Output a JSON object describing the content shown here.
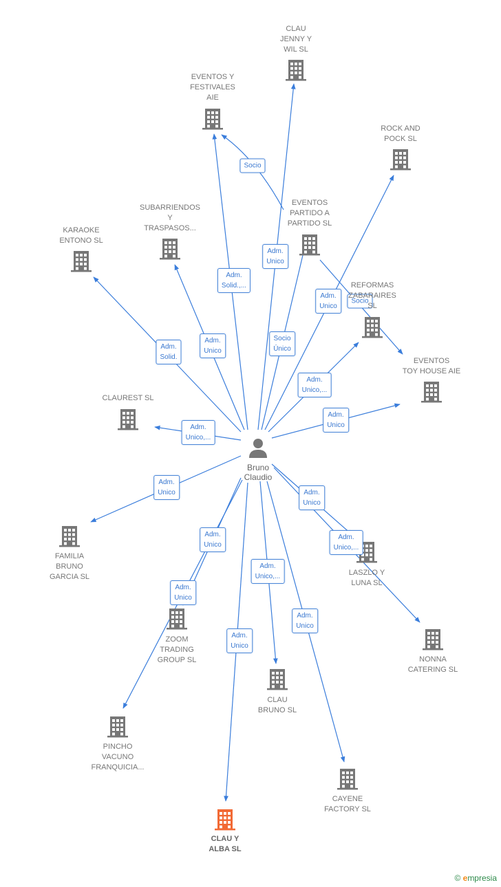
{
  "colors": {
    "edge": "#3a7ddb",
    "company": "#777777",
    "highlight": "#f26a35",
    "person": "#777777"
  },
  "person": {
    "name": "Bruno\nClaudio",
    "icon": "person-icon"
  },
  "nodes": [
    {
      "id": "clau-jenny",
      "label": "CLAU\nJENNY Y\nWIL  SL"
    },
    {
      "id": "eventos-festivales",
      "label": "EVENTOS Y\nFESTIVALES\nAIE"
    },
    {
      "id": "rock-pock",
      "label": "ROCK AND\nPOCK SL"
    },
    {
      "id": "eventos-partido",
      "label": "EVENTOS\nPARTIDO A\nPARTIDO  SL"
    },
    {
      "id": "subarriendos",
      "label": "SUBARRIENDOS\nY\nTRASPASOS..."
    },
    {
      "id": "karaoke",
      "label": "KARAOKE\nENTONO  SL"
    },
    {
      "id": "reformas",
      "label": "REFORMAS\nZABARAIRES\nSL"
    },
    {
      "id": "toy-house",
      "label": "EVENTOS\nTOY HOUSE AIE"
    },
    {
      "id": "claurest",
      "label": "CLAUREST  SL"
    },
    {
      "id": "familia",
      "label": "FAMILIA\nBRUNO\nGARCIA  SL"
    },
    {
      "id": "laszlo",
      "label": "LASZLO Y\nLUNA SL"
    },
    {
      "id": "zoom",
      "label": "ZOOM\nTRADING\nGROUP SL"
    },
    {
      "id": "nonna",
      "label": "NONNA\nCATERING  SL"
    },
    {
      "id": "clau-bruno",
      "label": "CLAU\nBRUNO  SL"
    },
    {
      "id": "pincho",
      "label": "PINCHO\nVACUNO\nFRANQUICIA..."
    },
    {
      "id": "cayene",
      "label": "CAYENE\nFACTORY SL"
    },
    {
      "id": "clau-alba",
      "label": "CLAU Y\nALBA  SL",
      "highlight": true
    }
  ],
  "edges": [
    {
      "to": "clau-jenny",
      "label": "Adm.\nUnico"
    },
    {
      "to": "eventos-festivales",
      "label": "Adm.\nSolid.,..."
    },
    {
      "from": "eventos-partido",
      "to": "eventos-festivales",
      "label": "Socio"
    },
    {
      "to": "rock-pock",
      "label": "Adm.\nUnico"
    },
    {
      "to": "eventos-partido",
      "label": "Socio\nÚnico"
    },
    {
      "to": "subarriendos",
      "label": "Adm.\nUnico"
    },
    {
      "to": "karaoke",
      "label": "Adm.\nSolid."
    },
    {
      "from": "eventos-partido",
      "to": "toy-house",
      "label": "Socio"
    },
    {
      "to": "reformas",
      "label": "Adm.\nUnico,..."
    },
    {
      "to": "toy-house",
      "label": "Adm.\nUnico"
    },
    {
      "to": "claurest",
      "label": "Adm.\nUnico,..."
    },
    {
      "to": "familia",
      "label": "Adm.\nUnico"
    },
    {
      "to": "laszlo",
      "label": "Adm.\nUnico"
    },
    {
      "to": "nonna",
      "label": "Adm.\nUnico,..."
    },
    {
      "to": "zoom",
      "label": "Adm.\nUnico"
    },
    {
      "to": "pincho",
      "label": "Adm.\nUnico"
    },
    {
      "to": "clau-bruno",
      "label": "Adm.\nUnico,..."
    },
    {
      "to": "cayene",
      "label": "Adm.\nUnico"
    },
    {
      "to": "clau-alba",
      "label": "Adm.\nUnico"
    }
  ],
  "footer": {
    "copyright": "©",
    "brand_initial": "e",
    "brand_rest": "mpresia"
  }
}
